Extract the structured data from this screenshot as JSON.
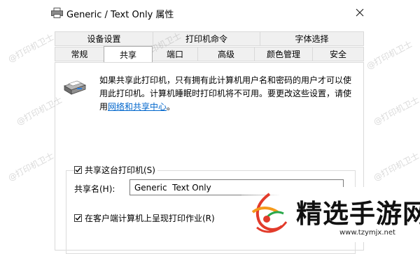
{
  "window": {
    "title": "Generic / Text Only 属性",
    "close_icon": "close-icon"
  },
  "tabs_row1": [
    "设备设置",
    "打印机命令",
    "字体选择"
  ],
  "tabs_row2": [
    "常规",
    "共享",
    "端口",
    "高级",
    "颜色管理",
    "安全"
  ],
  "active_tab": "共享",
  "description": {
    "text": "如果共享此打印机，只有拥有此计算机用户名和密码的用户才可以使用此打印机。计算机睡眠时打印机将不可用。要更改这些设置，请使用",
    "link": "网络和共享中心",
    "suffix": "。"
  },
  "share_checkbox": {
    "label": "共享这台打印机(S)",
    "checked": true
  },
  "share_name": {
    "label": "共享名(H):",
    "value": "Generic  Text Only"
  },
  "render_checkbox": {
    "label": "在客户端计算机上呈现打印作业(R)",
    "checked": true
  },
  "watermark": "@打印机卫士",
  "badge": {
    "name": "精选手游网",
    "url": "www.tzymjx.net"
  },
  "colors": {
    "accent": "#0066cc",
    "badge_red": "#e23b2b",
    "badge_orange": "#f59a1b",
    "badge_green": "#2aa84a"
  }
}
